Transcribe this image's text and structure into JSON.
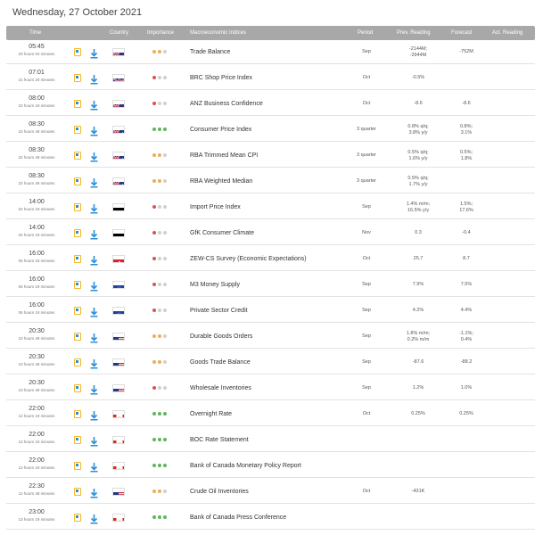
{
  "page": {
    "date_title": "Wednesday, 27 October 2021"
  },
  "header": {
    "time": "Time",
    "country": "Country",
    "importance": "Importance",
    "indicator": "Macroeconomic Indices",
    "period": "Period",
    "prev": "Prev. Reading",
    "forecast": "Forecast",
    "actual": "Act. Reading"
  },
  "colors": {
    "importance_low": "#d9534f",
    "importance_medium": "#f0ad4e",
    "importance_high": "#5cb85c",
    "dot_empty": "#d0d0d0"
  },
  "rows": [
    {
      "time": "05:45",
      "time_sub": "20 hours 04 minutes",
      "country": "NZ",
      "importance": 2,
      "event": "Trade Balance",
      "period": "Sep",
      "prev": "-2144M;\n-2944M",
      "forecast": "-752M"
    },
    {
      "time": "07:01",
      "time_sub": "21 hours 20 minutes",
      "country": "GB",
      "importance": 1,
      "event": "BRC Shop Price Index",
      "period": "Oct",
      "prev": "-0.5%",
      "forecast": ""
    },
    {
      "time": "08:00",
      "time_sub": "22 hours 19 minutes",
      "country": "NZ",
      "importance": 1,
      "event": "ANZ Business Confidence",
      "period": "Oct",
      "prev": "-8.6",
      "forecast": "-8.6"
    },
    {
      "time": "08:30",
      "time_sub": "22 hours 49 minutes",
      "country": "AU",
      "importance": 3,
      "event": "Consumer Price Index",
      "period": "3 quarter",
      "prev": "0.8% q/q;\n3.8% y/y",
      "forecast": "0.8%;\n3.1%"
    },
    {
      "time": "08:30",
      "time_sub": "22 hours 49 minutes",
      "country": "AU",
      "importance": 2,
      "event": "RBA Trimmed Mean CPI",
      "period": "3 quarter",
      "prev": "0.5% q/q;\n1.6% y/y",
      "forecast": "0.5%;\n1.8%"
    },
    {
      "time": "08:30",
      "time_sub": "22 hours 49 minutes",
      "country": "AU",
      "importance": 2,
      "event": "RBA Weighted Median",
      "period": "3 quarter",
      "prev": "0.5% q/q;\n1.7% y/y",
      "forecast": ""
    },
    {
      "time": "14:00",
      "time_sub": "04 hours 19 minutes",
      "country": "DE",
      "importance": 1,
      "event": "Import Price Index",
      "period": "Sep",
      "prev": "1.4% m/m;\n16.5% y/y",
      "forecast": "1.5%;\n17.6%"
    },
    {
      "time": "14:00",
      "time_sub": "04 hours 19 minutes",
      "country": "DE",
      "importance": 1,
      "event": "GfK Consumer Climate",
      "period": "Nov",
      "prev": "0.3",
      "forecast": "-0.4"
    },
    {
      "time": "16:00",
      "time_sub": "06 hours 19 minutes",
      "country": "CH",
      "importance": 1,
      "event": "ZEW-CS Survey (Economic Expectations)",
      "period": "Oct",
      "prev": "25.7",
      "forecast": "8.7"
    },
    {
      "time": "16:00",
      "time_sub": "06 hours 19 minutes",
      "country": "EU",
      "importance": 1,
      "event": "M3 Money Supply",
      "period": "Sep",
      "prev": "7.9%",
      "forecast": "7.5%"
    },
    {
      "time": "16:00",
      "time_sub": "06 hours 19 minutes",
      "country": "EU",
      "importance": 1,
      "event": "Private Sector Credit",
      "period": "Sep",
      "prev": "4.2%",
      "forecast": "4.4%"
    },
    {
      "time": "20:30",
      "time_sub": "10 hours 49 minutes",
      "country": "US",
      "importance": 2,
      "event": "Durable Goods Orders",
      "period": "Sep",
      "prev": "1.8% m/m;\n0.2% m/m",
      "forecast": "-1.1%;\n0.4%"
    },
    {
      "time": "20:30",
      "time_sub": "10 hours 49 minutes",
      "country": "US",
      "importance": 2,
      "event": "Goods Trade Balance",
      "period": "Sep",
      "prev": "-87.6",
      "forecast": "-88.2"
    },
    {
      "time": "20:30",
      "time_sub": "10 hours 49 minutes",
      "country": "US",
      "importance": 1,
      "event": "Wholesale Inventories",
      "period": "Sep",
      "prev": "1.2%",
      "forecast": "1.0%"
    },
    {
      "time": "22:00",
      "time_sub": "12 hours 19 minutes",
      "country": "CA",
      "importance": 3,
      "event": "Overnight Rate",
      "period": "Oct",
      "prev": "0.25%",
      "forecast": "0.25%"
    },
    {
      "time": "22:00",
      "time_sub": "12 hours 19 minutes",
      "country": "CA",
      "importance": 3,
      "event": "BOC Rate Statement",
      "period": "",
      "prev": "",
      "forecast": ""
    },
    {
      "time": "22:00",
      "time_sub": "12 hours 19 minutes",
      "country": "CA",
      "importance": 3,
      "event": "Bank of Canada Monetary Policy Report",
      "period": "",
      "prev": "",
      "forecast": ""
    },
    {
      "time": "22:30",
      "time_sub": "12 hours 49 minutes",
      "country": "US",
      "importance": 2,
      "event": "Crude Oil Inventories",
      "period": "Oct",
      "prev": "-431K",
      "forecast": ""
    },
    {
      "time": "23:00",
      "time_sub": "13 hours 19 minutes",
      "country": "CA",
      "importance": 3,
      "event": "Bank of Canada Press Conference",
      "period": "",
      "prev": "",
      "forecast": ""
    }
  ]
}
